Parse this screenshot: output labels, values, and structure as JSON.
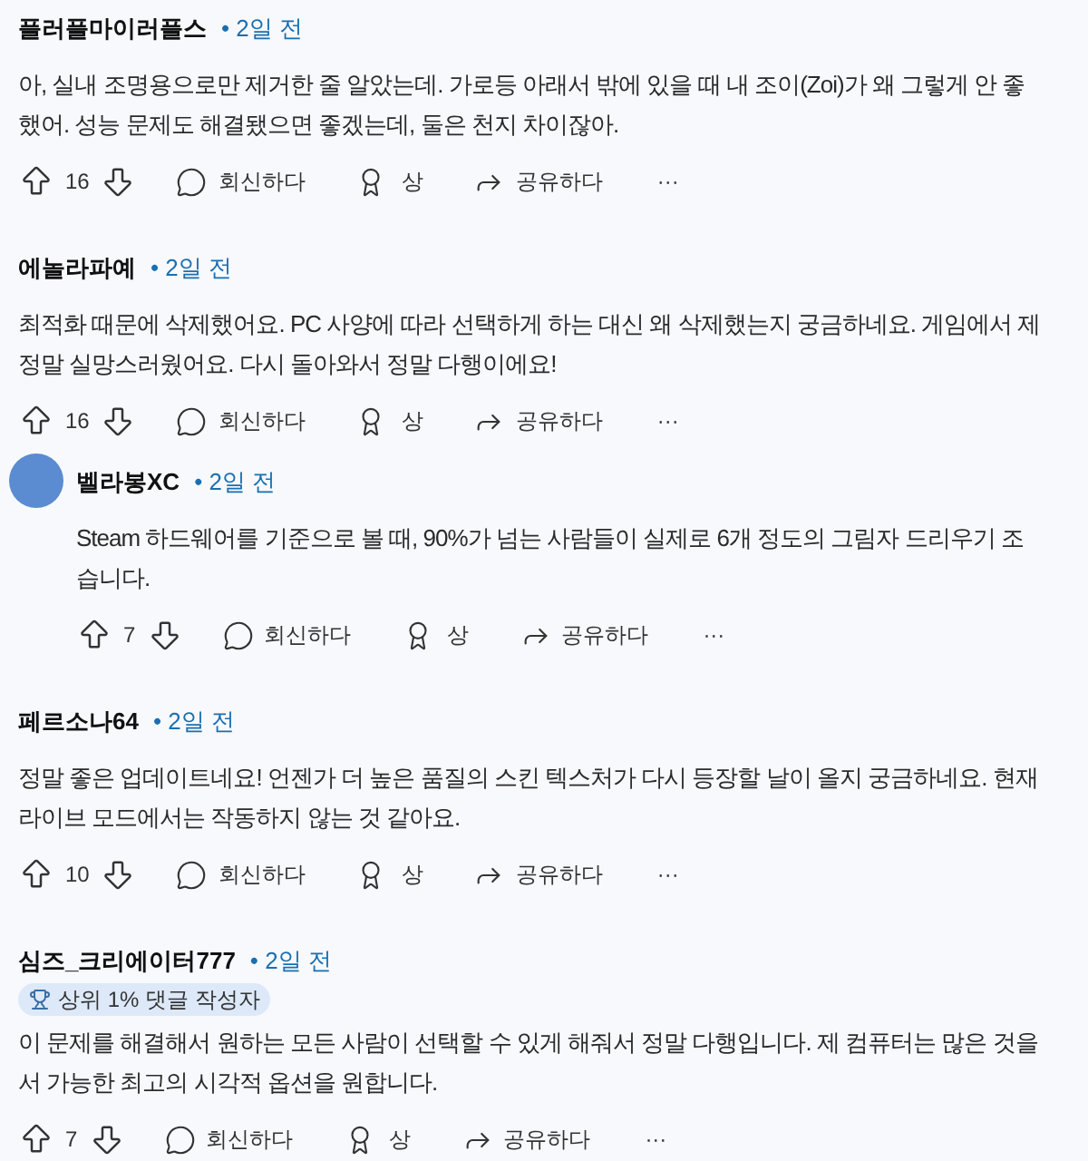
{
  "comments": [
    {
      "author": "플러플마이러플스",
      "time": "• 2일 전",
      "nested": false,
      "body": [
        "아, 실내 조명용으로만 제거한 줄 알았는데. 가로등 아래서 밖에 있을 때 내 조이(Zoi)가 왜 그렇게 안 좋",
        "했어. 성능 문제도 해결됐으면 좋겠는데, 둘은 천지 차이잖아."
      ],
      "votes": "16",
      "reply": "회신하다",
      "award": "상",
      "share": "공유하다",
      "more": "···"
    },
    {
      "author": "에놀라파예",
      "time": "• 2일 전",
      "nested": false,
      "body": [
        "최적화 때문에 삭제했어요. PC 사양에 따라 선택하게 하는 대신 왜 삭제했는지 궁금하네요. 게임에서 제",
        "정말 실망스러웠어요. 다시 돌아와서 정말 다행이에요!"
      ],
      "votes": "16",
      "reply": "회신하다",
      "award": "상",
      "share": "공유하다",
      "more": "···"
    },
    {
      "author": "벨라봉XC",
      "time": "• 2일 전",
      "nested": true,
      "body": [
        "Steam 하드웨어를 기준으로 볼 때, 90%가 넘는 사람들이 실제로 6개 정도의 그림자 드리우기 조",
        "습니다."
      ],
      "votes": "7",
      "reply": "회신하다",
      "award": "상",
      "share": "공유하다",
      "more": "···"
    },
    {
      "author": "페르소나64",
      "time": "• 2일 전",
      "nested": false,
      "body": [
        "정말 좋은 업데이트네요! 언젠가 더 높은 품질의 스킨 텍스처가 다시 등장할 날이 올지 궁금하네요. 현재",
        "라이브 모드에서는 작동하지 않는 것 같아요."
      ],
      "votes": "10",
      "reply": "회신하다",
      "award": "상",
      "share": "공유하다",
      "more": "···"
    },
    {
      "author": "심즈_크리에이터777",
      "time": "• 2일 전",
      "nested": false,
      "badge": "상위 1% 댓글 작성자",
      "body": [
        "이 문제를 해결해서 원하는 모든 사람이 선택할 수 있게 해줘서 정말 다행입니다. 제 컴퓨터는 많은 것을",
        "서 가능한 최고의 시각적 옵션을 원합니다."
      ],
      "votes": "7",
      "reply": "회신하다",
      "award": "상",
      "share": "공유하다",
      "more": "···"
    }
  ]
}
